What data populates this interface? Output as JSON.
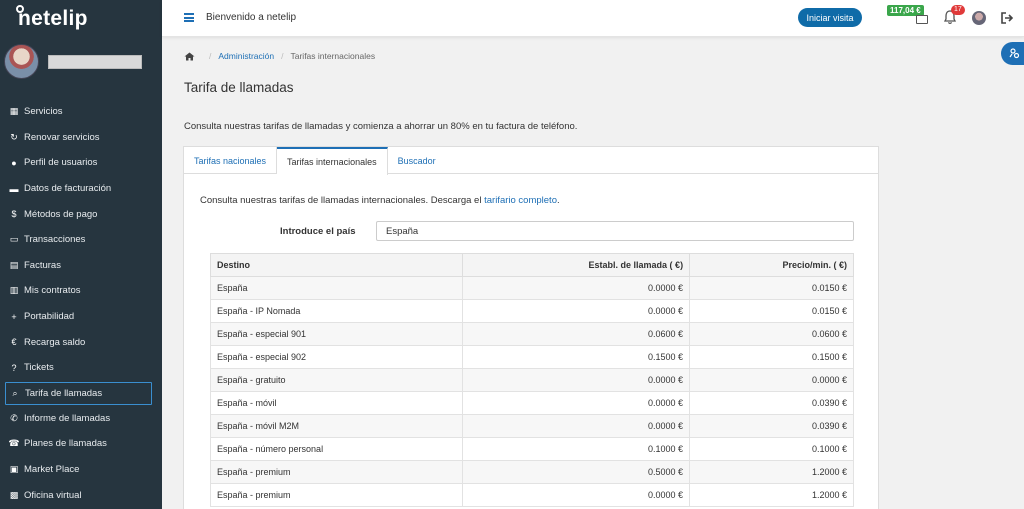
{
  "app": {
    "logo_text": "netelip"
  },
  "sidebar": {
    "items": [
      {
        "label": "Servicios",
        "icon": "grid-icon"
      },
      {
        "label": "Renovar servicios",
        "icon": "refresh-icon"
      },
      {
        "label": "Perfil de usuarios",
        "icon": "user-icon"
      },
      {
        "label": "Datos de facturación",
        "icon": "briefcase-icon"
      },
      {
        "label": "Métodos de pago",
        "icon": "dollar-icon"
      },
      {
        "label": "Transacciones",
        "icon": "card-icon"
      },
      {
        "label": "Facturas",
        "icon": "invoice-icon"
      },
      {
        "label": "Mis contratos",
        "icon": "contract-icon"
      },
      {
        "label": "Portabilidad",
        "icon": "plus-icon"
      },
      {
        "label": "Recarga saldo",
        "icon": "euro-icon"
      },
      {
        "label": "Tickets",
        "icon": "help-icon"
      },
      {
        "label": "Tarifa de llamadas",
        "icon": "search-icon",
        "active": true
      },
      {
        "label": "Informe de llamadas",
        "icon": "phone-icon"
      },
      {
        "label": "Planes de llamadas",
        "icon": "phone-plan-icon"
      },
      {
        "label": "Market Place",
        "icon": "store-icon"
      },
      {
        "label": "Oficina virtual",
        "icon": "office-icon"
      }
    ]
  },
  "topbar": {
    "welcome": "Bienvenido a netelip",
    "visit_button": "Iniciar visita",
    "balance": "117,04 €",
    "notifications": "17"
  },
  "breadcrumb": {
    "admin": "Administración",
    "current": "Tarifas internacionales"
  },
  "page": {
    "title": "Tarifa de llamadas",
    "intro": "Consulta nuestras tarifas de llamadas y comienza a ahorrar un 80% en tu factura de teléfono."
  },
  "tabs": [
    {
      "label": "Tarifas nacionales"
    },
    {
      "label": "Tarifas internacionales",
      "active": true
    },
    {
      "label": "Buscador"
    }
  ],
  "panel": {
    "desc_prefix": "Consulta nuestras tarifas de llamadas internacionales. Descarga el ",
    "desc_link": "tarifario completo",
    "desc_suffix": ".",
    "country_label": "Introduce el país",
    "country_value": "España"
  },
  "table": {
    "headers": [
      "Destino",
      "Establ. de llamada ( €)",
      "Precio/min. ( €)"
    ],
    "rows": [
      [
        "España",
        "0.0000 €",
        "0.0150 €"
      ],
      [
        "España - IP Nomada",
        "0.0000 €",
        "0.0150 €"
      ],
      [
        "España - especial 901",
        "0.0600 €",
        "0.0600 €"
      ],
      [
        "España - especial 902",
        "0.1500 €",
        "0.1500 €"
      ],
      [
        "España - gratuito",
        "0.0000 €",
        "0.0000 €"
      ],
      [
        "España - móvil",
        "0.0000 €",
        "0.0390 €"
      ],
      [
        "España - móvil M2M",
        "0.0000 €",
        "0.0390 €"
      ],
      [
        "España - número personal",
        "0.1000 €",
        "0.1000 €"
      ],
      [
        "España - premium",
        "0.5000 €",
        "1.2000 €"
      ],
      [
        "España - premium",
        "0.0000 €",
        "1.2000 €"
      ]
    ]
  },
  "colors": {
    "sidebar": "#26353f",
    "accent": "#1e6fb5",
    "balance": "#3aa64b",
    "notification": "#e03a3a"
  }
}
